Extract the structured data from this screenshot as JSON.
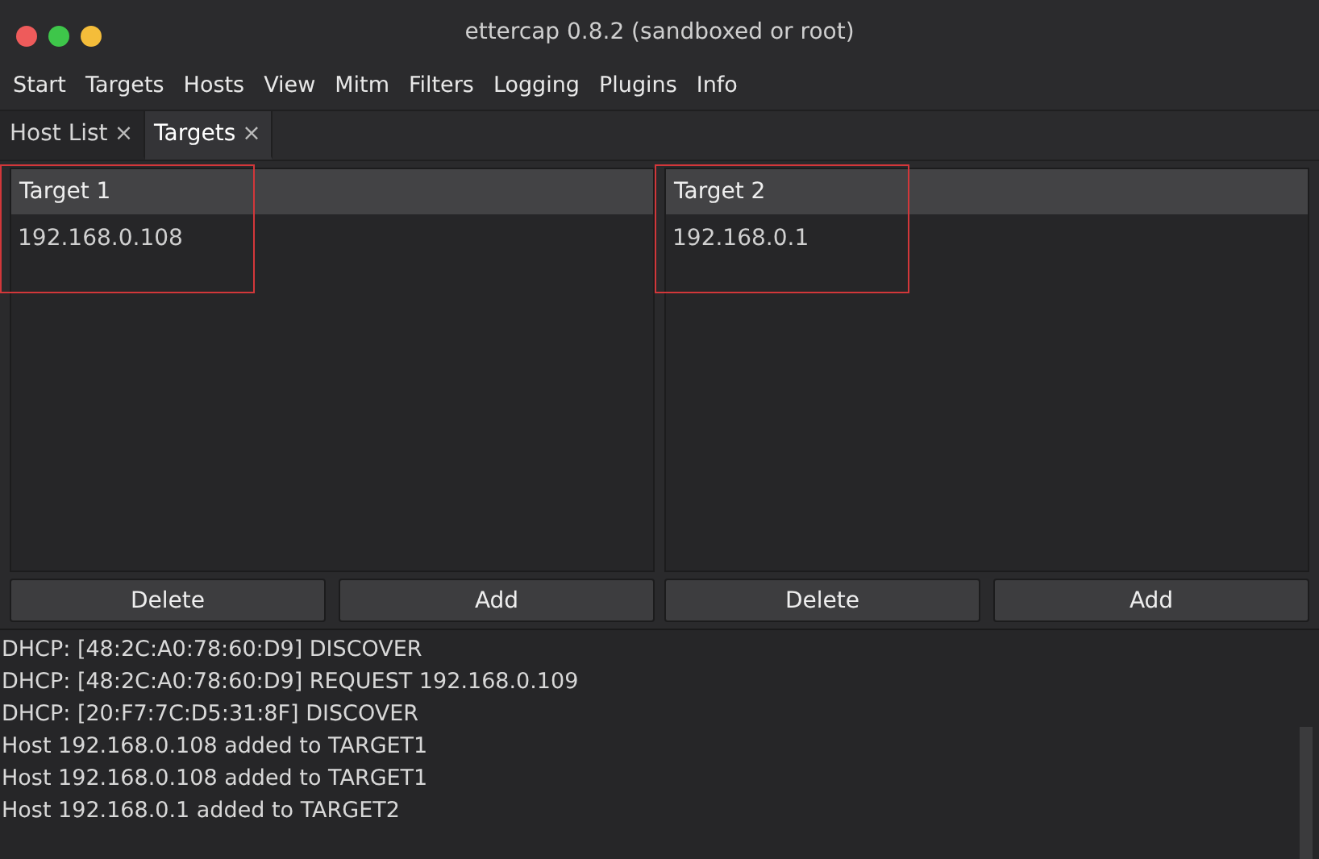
{
  "window": {
    "title": "ettercap 0.8.2 (sandboxed or root)"
  },
  "menu": [
    "Start",
    "Targets",
    "Hosts",
    "View",
    "Mitm",
    "Filters",
    "Logging",
    "Plugins",
    "Info"
  ],
  "tabs": [
    {
      "label": "Host List",
      "close": "×",
      "selected": false
    },
    {
      "label": "Targets",
      "close": "×",
      "selected": true
    }
  ],
  "targets": [
    {
      "heading": "Target 1",
      "hosts": [
        "192.168.0.108"
      ],
      "highlighted": true,
      "buttons": [
        "Delete",
        "Add"
      ]
    },
    {
      "heading": "Target 2",
      "hosts": [
        "192.168.0.1"
      ],
      "highlighted": true,
      "buttons": [
        "Delete",
        "Add"
      ]
    }
  ],
  "log": [
    "DHCP: [48:2C:A0:78:60:D9] DISCOVER",
    "DHCP: [48:2C:A0:78:60:D9] REQUEST 192.168.0.109",
    "DHCP: [20:F7:7C:D5:31:8F] DISCOVER",
    "Host 192.168.0.108 added to TARGET1",
    "Host 192.168.0.108 added to TARGET1",
    "Host 192.168.0.1 added to TARGET2"
  ]
}
